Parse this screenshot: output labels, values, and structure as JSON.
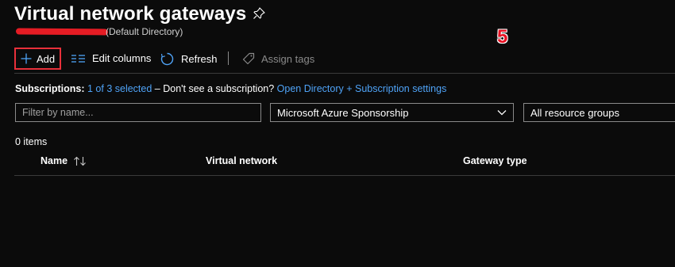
{
  "header": {
    "title": "Virtual network gateways",
    "directory": "(Default Directory)"
  },
  "annotation": {
    "step_number": "5"
  },
  "toolbar": {
    "add_label": "Add",
    "edit_columns_label": "Edit columns",
    "refresh_label": "Refresh",
    "assign_tags_label": "Assign tags"
  },
  "subscriptions": {
    "label": "Subscriptions:",
    "selected_link": "1 of 3 selected",
    "prompt": "– Don't see a subscription?",
    "settings_link": "Open Directory + Subscription settings"
  },
  "filters": {
    "name_placeholder": "Filter by name...",
    "subscription_value": "Microsoft Azure Sponsorship",
    "resource_group_value": "All resource groups"
  },
  "list": {
    "item_count": "0 items",
    "columns": [
      "Name",
      "Virtual network",
      "Gateway type"
    ]
  },
  "colors": {
    "background": "#0b0b0b",
    "link": "#4fa3f7",
    "highlight": "#e8303a",
    "accent_blue": "#4fa3f7"
  }
}
